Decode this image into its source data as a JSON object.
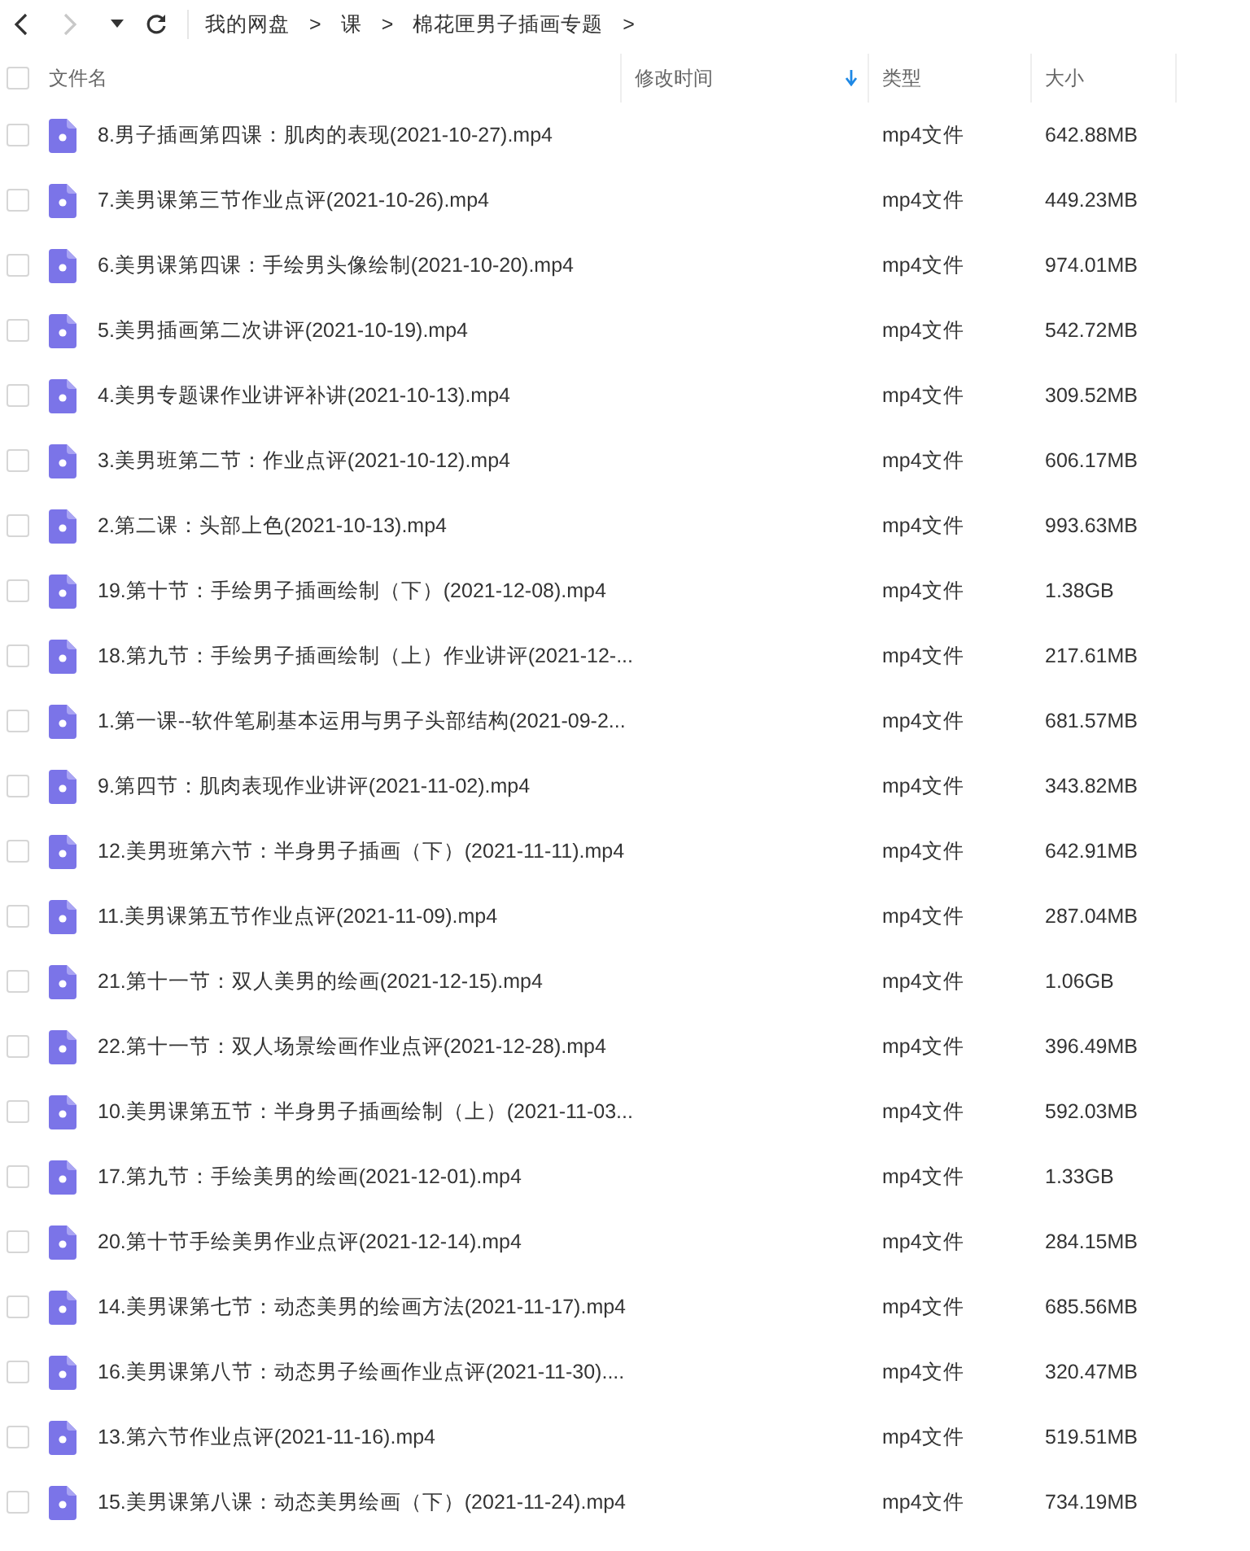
{
  "toolbar": {
    "breadcrumb": [
      {
        "label": "我的网盘"
      },
      {
        "label": "课"
      },
      {
        "label": "棉花匣男子插画专题"
      }
    ],
    "separator": ">",
    "back_disabled": false,
    "forward_disabled": true
  },
  "table": {
    "select_all": {
      "checked": false
    },
    "columns": [
      {
        "label": "文件名",
        "sorted": false
      },
      {
        "label": "修改时间",
        "sorted": true
      },
      {
        "label": "类型",
        "sorted": false
      },
      {
        "label": "大小",
        "sorted": false
      }
    ],
    "rows": [
      {
        "name": "8.男子插画第四课：肌肉的表现(2021-10-27).mp4",
        "type": "mp4文件",
        "size": "642.88MB",
        "checked": false
      },
      {
        "name": "7.美男课第三节作业点评(2021-10-26).mp4",
        "type": "mp4文件",
        "size": "449.23MB",
        "checked": false
      },
      {
        "name": "6.美男课第四课：手绘男头像绘制(2021-10-20).mp4",
        "type": "mp4文件",
        "size": "974.01MB",
        "checked": false
      },
      {
        "name": "5.美男插画第二次讲评(2021-10-19).mp4",
        "type": "mp4文件",
        "size": "542.72MB",
        "checked": false
      },
      {
        "name": "4.美男专题课作业讲评补讲(2021-10-13).mp4",
        "type": "mp4文件",
        "size": "309.52MB",
        "checked": false
      },
      {
        "name": "3.美男班第二节：作业点评(2021-10-12).mp4",
        "type": "mp4文件",
        "size": "606.17MB",
        "checked": false
      },
      {
        "name": "2.第二课：头部上色(2021-10-13).mp4",
        "type": "mp4文件",
        "size": "993.63MB",
        "checked": false
      },
      {
        "name": "19.第十节：手绘男子插画绘制（下）(2021-12-08).mp4",
        "type": "mp4文件",
        "size": "1.38GB",
        "checked": false
      },
      {
        "name": "18.第九节：手绘男子插画绘制（上）作业讲评(2021-12-...",
        "type": "mp4文件",
        "size": "217.61MB",
        "checked": false
      },
      {
        "name": "1.第一课--软件笔刷基本运用与男子头部结构(2021-09-2...",
        "type": "mp4文件",
        "size": "681.57MB",
        "checked": false
      },
      {
        "name": "9.第四节：肌肉表现作业讲评(2021-11-02).mp4",
        "type": "mp4文件",
        "size": "343.82MB",
        "checked": false
      },
      {
        "name": "12.美男班第六节：半身男子插画（下）(2021-11-11).mp4",
        "type": "mp4文件",
        "size": "642.91MB",
        "checked": false
      },
      {
        "name": "11.美男课第五节作业点评(2021-11-09).mp4",
        "type": "mp4文件",
        "size": "287.04MB",
        "checked": false
      },
      {
        "name": "21.第十一节：双人美男的绘画(2021-12-15).mp4",
        "type": "mp4文件",
        "size": "1.06GB",
        "checked": false
      },
      {
        "name": "22.第十一节：双人场景绘画作业点评(2021-12-28).mp4",
        "type": "mp4文件",
        "size": "396.49MB",
        "checked": false
      },
      {
        "name": "10.美男课第五节：半身男子插画绘制（上）(2021-11-03...",
        "type": "mp4文件",
        "size": "592.03MB",
        "checked": false
      },
      {
        "name": "17.第九节：手绘美男的绘画(2021-12-01).mp4",
        "type": "mp4文件",
        "size": "1.33GB",
        "checked": false
      },
      {
        "name": "20.第十节手绘美男作业点评(2021-12-14).mp4",
        "type": "mp4文件",
        "size": "284.15MB",
        "checked": false
      },
      {
        "name": "14.美男课第七节：动态美男的绘画方法(2021-11-17).mp4",
        "type": "mp4文件",
        "size": "685.56MB",
        "checked": false
      },
      {
        "name": "16.美男课第八节：动态男子绘画作业点评(2021-11-30)....",
        "type": "mp4文件",
        "size": "320.47MB",
        "checked": false
      },
      {
        "name": "13.第六节作业点评(2021-11-16).mp4",
        "type": "mp4文件",
        "size": "519.51MB",
        "checked": false
      },
      {
        "name": "15.美男课第八课：动态美男绘画（下）(2021-11-24).mp4",
        "type": "mp4文件",
        "size": "734.19MB",
        "checked": false
      }
    ]
  }
}
